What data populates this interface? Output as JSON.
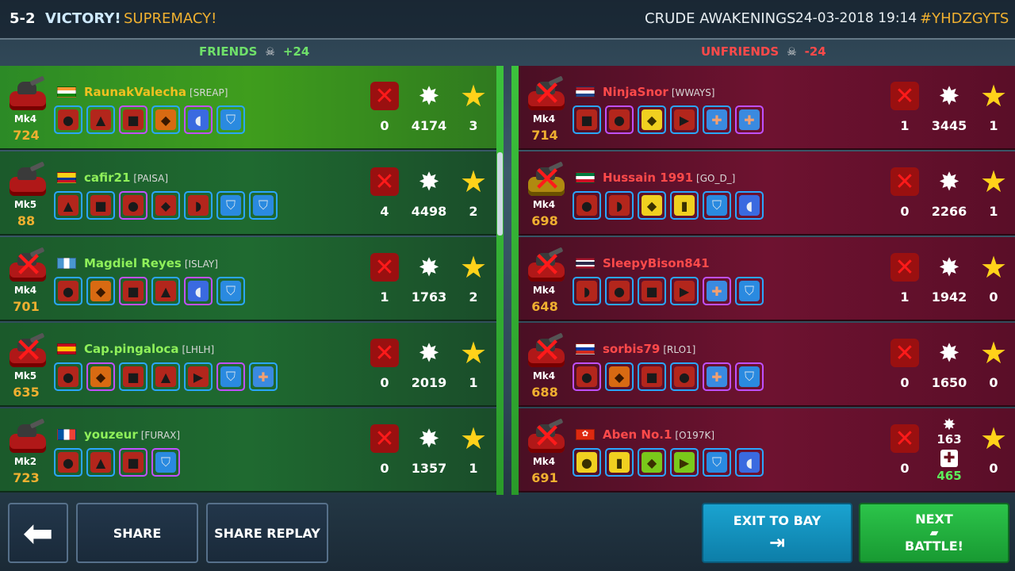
{
  "header": {
    "score": "5-2",
    "result": "VICTORY!",
    "mode": "SUPREMACY!",
    "map": "CRUDE AWAKENINGS",
    "datetime": "24-03-2018 19:14",
    "code": "#YHDZGYTS"
  },
  "teams": {
    "friends": {
      "label": "FRIENDS",
      "delta": "+24"
    },
    "unfriends": {
      "label": "UNFRIENDS",
      "delta": "-24"
    }
  },
  "friends_players": [
    {
      "name": "RaunakValecha",
      "clan": "[SREAP]",
      "mk": "Mk4",
      "rating": "724",
      "kills": "0",
      "damage": "4174",
      "score": "3",
      "flag": "india",
      "destroyed": false,
      "highlight": true
    },
    {
      "name": "cafir21",
      "clan": "[PAISA]",
      "mk": "Mk5",
      "rating": "88",
      "kills": "4",
      "damage": "4498",
      "score": "2",
      "flag": "colombia",
      "destroyed": false,
      "highlight": false
    },
    {
      "name": "Magdiel Reyes",
      "clan": "[ISLAY]",
      "mk": "Mk4",
      "rating": "701",
      "kills": "1",
      "damage": "1763",
      "score": "2",
      "flag": "guatemala",
      "destroyed": true,
      "highlight": false
    },
    {
      "name": "Cap.pingaloca",
      "clan": "[LHLH]",
      "mk": "Mk5",
      "rating": "635",
      "kills": "0",
      "damage": "2019",
      "score": "1",
      "flag": "spain",
      "destroyed": true,
      "highlight": false
    },
    {
      "name": "youzeur",
      "clan": "[FURAX]",
      "mk": "Mk2",
      "rating": "723",
      "kills": "0",
      "damage": "1357",
      "score": "1",
      "flag": "france",
      "destroyed": false,
      "highlight": false
    }
  ],
  "unfriends_players": [
    {
      "name": "NinjaSnor",
      "clan": "[WWAYS]",
      "mk": "Mk4",
      "rating": "714",
      "kills": "1",
      "damage": "3445",
      "score": "1",
      "flag": "netherlands",
      "destroyed": true
    },
    {
      "name": "Hussain 1991",
      "clan": "[GO_D_]",
      "mk": "Mk4",
      "rating": "698",
      "kills": "0",
      "damage": "2266",
      "score": "1",
      "flag": "kuwait",
      "destroyed": true
    },
    {
      "name": "SleepyBison841",
      "clan": "",
      "mk": "Mk4",
      "rating": "648",
      "kills": "1",
      "damage": "1942",
      "score": "0",
      "flag": "thailand",
      "destroyed": true
    },
    {
      "name": "sorbis79",
      "clan": "[RLO1]",
      "mk": "Mk4",
      "rating": "688",
      "kills": "0",
      "damage": "1650",
      "score": "0",
      "flag": "russia",
      "destroyed": true
    },
    {
      "name": "Aben No.1",
      "clan": "[O197K]",
      "mk": "Mk4",
      "rating": "691",
      "kills": "0",
      "damage": "163",
      "heal": "465",
      "score": "0",
      "flag": "hongkong",
      "destroyed": true
    }
  ],
  "buttons": {
    "share": "SHARE",
    "share_replay": "SHARE REPLAY",
    "exit": "EXIT TO BAY",
    "next_line1": "NEXT",
    "next_line2": "BATTLE!"
  },
  "colors": {
    "friend_name": "#8ff05a",
    "highlight_name": "#f0c020",
    "enemy_name": "#ff4a4a",
    "rating": "#f0b030"
  }
}
